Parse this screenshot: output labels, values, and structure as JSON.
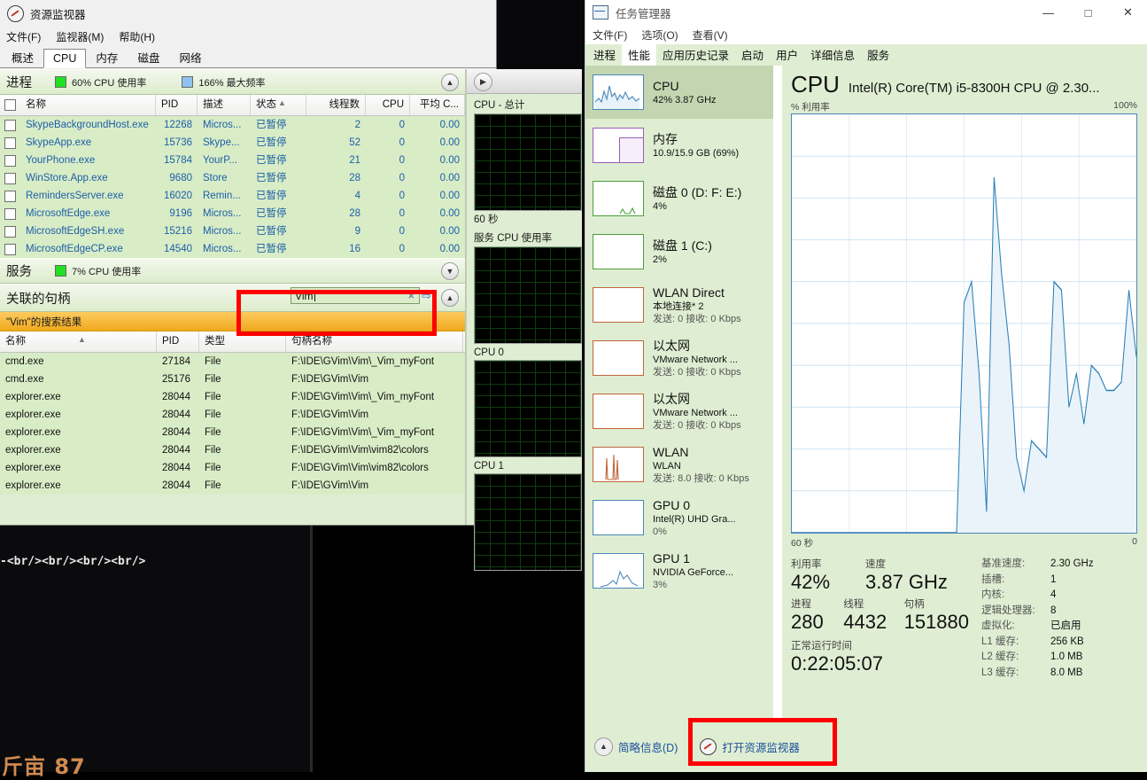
{
  "desktop": {
    "editor_line": "-<br/><br/><br/><br/>",
    "editor_bottom": "斤亩 87"
  },
  "resource_monitor": {
    "title": "资源监视器",
    "icon": "gauge-icon",
    "menu": [
      "文件(F)",
      "监视器(M)",
      "帮助(H)"
    ],
    "tabs": [
      "概述",
      "CPU",
      "内存",
      "磁盘",
      "网络"
    ],
    "active_tab": "CPU",
    "process_section": {
      "title": "进程",
      "stat_cpu": "60% CPU 使用率",
      "stat_freq": "166% 最大频率",
      "columns": [
        "名称",
        "PID",
        "描述",
        "状态",
        "线程数",
        "CPU",
        "平均 C..."
      ],
      "rows": [
        {
          "name": "SkypeBackgroundHost.exe",
          "pid": "12268",
          "desc": "Micros...",
          "status": "已暂停",
          "threads": "2",
          "cpu": "0",
          "avg": "0.00"
        },
        {
          "name": "SkypeApp.exe",
          "pid": "15736",
          "desc": "Skype...",
          "status": "已暂停",
          "threads": "52",
          "cpu": "0",
          "avg": "0.00"
        },
        {
          "name": "YourPhone.exe",
          "pid": "15784",
          "desc": "YourP...",
          "status": "已暂停",
          "threads": "21",
          "cpu": "0",
          "avg": "0.00"
        },
        {
          "name": "WinStore.App.exe",
          "pid": "9680",
          "desc": "Store",
          "status": "已暂停",
          "threads": "28",
          "cpu": "0",
          "avg": "0.00"
        },
        {
          "name": "RemindersServer.exe",
          "pid": "16020",
          "desc": "Remin...",
          "status": "已暂停",
          "threads": "4",
          "cpu": "0",
          "avg": "0.00"
        },
        {
          "name": "MicrosoftEdge.exe",
          "pid": "9196",
          "desc": "Micros...",
          "status": "已暂停",
          "threads": "28",
          "cpu": "0",
          "avg": "0.00"
        },
        {
          "name": "MicrosoftEdgeSH.exe",
          "pid": "15216",
          "desc": "Micros...",
          "status": "已暂停",
          "threads": "9",
          "cpu": "0",
          "avg": "0.00"
        },
        {
          "name": "MicrosoftEdgeCP.exe",
          "pid": "14540",
          "desc": "Micros...",
          "status": "已暂停",
          "threads": "16",
          "cpu": "0",
          "avg": "0.00"
        }
      ]
    },
    "services_section": {
      "title": "服务",
      "stat_cpu": "7% CPU 使用率"
    },
    "handles_section": {
      "title": "关联的句柄",
      "search_value": "Vim",
      "clear_icon": "×",
      "search_icon": "search-arrow-icon",
      "results_banner": "\"Vim\"的搜索结果",
      "columns": [
        "名称",
        "PID",
        "类型",
        "句柄名称"
      ],
      "rows": [
        {
          "name": "cmd.exe",
          "pid": "27184",
          "type": "File",
          "handle": "F:\\IDE\\GVim\\Vim\\_Vim_myFont"
        },
        {
          "name": "cmd.exe",
          "pid": "25176",
          "type": "File",
          "handle": "F:\\IDE\\GVim\\Vim"
        },
        {
          "name": "explorer.exe",
          "pid": "28044",
          "type": "File",
          "handle": "F:\\IDE\\GVim\\Vim\\_Vim_myFont"
        },
        {
          "name": "explorer.exe",
          "pid": "28044",
          "type": "File",
          "handle": "F:\\IDE\\GVim\\Vim"
        },
        {
          "name": "explorer.exe",
          "pid": "28044",
          "type": "File",
          "handle": "F:\\IDE\\GVim\\Vim\\_Vim_myFont"
        },
        {
          "name": "explorer.exe",
          "pid": "28044",
          "type": "File",
          "handle": "F:\\IDE\\GVim\\Vim\\vim82\\colors"
        },
        {
          "name": "explorer.exe",
          "pid": "28044",
          "type": "File",
          "handle": "F:\\IDE\\GVim\\Vim\\vim82\\colors"
        },
        {
          "name": "explorer.exe",
          "pid": "28044",
          "type": "File",
          "handle": "F:\\IDE\\GVim\\Vim"
        }
      ]
    },
    "graph_column": {
      "graphs": [
        {
          "label": "CPU - 总计",
          "footer": "60 秒"
        },
        {
          "label": "服务 CPU 使用率",
          "footer": ""
        },
        {
          "label": "CPU 0",
          "footer": ""
        },
        {
          "label": "CPU 1",
          "footer": ""
        }
      ]
    }
  },
  "task_manager": {
    "title": "任务管理器",
    "icon": "chart-window-icon",
    "window_buttons": {
      "minimize": "—",
      "maximize": "□",
      "close": "✕"
    },
    "menu": [
      "文件(F)",
      "选项(O)",
      "查看(V)"
    ],
    "tabs": [
      "进程",
      "性能",
      "应用历史记录",
      "启动",
      "用户",
      "详细信息",
      "服务"
    ],
    "active_tab": "性能",
    "sidebar": [
      {
        "name": "CPU",
        "line2": "42% 3.87 GHz",
        "line3": "",
        "color": "#4a87b8",
        "selected": true,
        "spark": "cpu"
      },
      {
        "name": "内存",
        "line2": "10.9/15.9 GB (69%)",
        "line3": "",
        "color": "#9b59b6",
        "selected": false,
        "spark": "mem"
      },
      {
        "name": "磁盘 0 (D: F: E:)",
        "line2": "4%",
        "line3": "",
        "color": "#4d9e3f",
        "selected": false,
        "spark": "disk0"
      },
      {
        "name": "磁盘 1 (C:)",
        "line2": "2%",
        "line3": "",
        "color": "#4d9e3f",
        "selected": false,
        "spark": "flat"
      },
      {
        "name": "WLAN Direct",
        "line2": "本地连接* 2",
        "line3": "发送: 0 接收: 0 Kbps",
        "color": "#c0653a",
        "selected": false,
        "spark": "flat"
      },
      {
        "name": "以太网",
        "line2": "VMware Network ...",
        "line3": "发送: 0 接收: 0 Kbps",
        "color": "#c0653a",
        "selected": false,
        "spark": "flat"
      },
      {
        "name": "以太网",
        "line2": "VMware Network ...",
        "line3": "发送: 0 接收: 0 Kbps",
        "color": "#c0653a",
        "selected": false,
        "spark": "flat"
      },
      {
        "name": "WLAN",
        "line2": "WLAN",
        "line3": "发送: 8.0 接收: 0 Kbps",
        "color": "#c0653a",
        "selected": false,
        "spark": "wlan"
      },
      {
        "name": "GPU 0",
        "line2": "Intel(R) UHD Gra...",
        "line3": "0%",
        "color": "#4a87b8",
        "selected": false,
        "spark": "flat"
      },
      {
        "name": "GPU 1",
        "line2": "NVIDIA GeForce...",
        "line3": "3%",
        "color": "#4a87b8",
        "selected": false,
        "spark": "gpu"
      }
    ],
    "detail": {
      "heading": "CPU",
      "subheading": "Intel(R) Core(TM) i5-8300H CPU @ 2.30...",
      "axis_left": "% 利用率",
      "axis_right": "100%",
      "axis_time_left": "60 秒",
      "axis_time_right": "0",
      "stats_left": [
        {
          "label": "利用率",
          "value": "42%"
        },
        {
          "label": "速度",
          "value": "3.87 GHz"
        },
        {
          "label": "进程",
          "value": "280"
        },
        {
          "label": "线程",
          "value": "4432"
        },
        {
          "label": "句柄",
          "value": "151880"
        },
        {
          "label": "正常运行时间",
          "value": "0:22:05:07"
        }
      ],
      "stats_right": [
        {
          "key": "基准速度:",
          "value": "2.30 GHz"
        },
        {
          "key": "插槽:",
          "value": "1"
        },
        {
          "key": "内核:",
          "value": "4"
        },
        {
          "key": "逻辑处理器:",
          "value": "8"
        },
        {
          "key": "虚拟化:",
          "value": "已启用"
        },
        {
          "key": "L1 缓存:",
          "value": "256 KB"
        },
        {
          "key": "L2 缓存:",
          "value": "1.0 MB"
        },
        {
          "key": "L3 缓存:",
          "value": "8.0 MB"
        }
      ]
    },
    "footer": {
      "fewer_details": "简略信息(D)",
      "open_resmon": "打开资源监视器",
      "open_resmon_icon": "gauge-icon"
    }
  },
  "chart_data": {
    "type": "area",
    "title": "CPU % 利用率",
    "ylabel": "% 利用率",
    "xlabel": "60 秒",
    "ylim": [
      0,
      100
    ],
    "xlim": [
      0,
      60
    ],
    "grid": true,
    "line_color": "#2a7fb8",
    "fill_color": "#eaf3fa",
    "x": [
      0,
      2,
      4,
      6,
      8,
      10,
      12,
      14,
      16,
      18,
      20,
      22,
      24,
      26,
      28,
      30,
      32,
      34,
      36,
      38,
      40,
      42,
      44,
      46,
      48,
      50,
      52,
      54,
      56,
      58,
      60
    ],
    "values": [
      0,
      0,
      0,
      0,
      0,
      0,
      0,
      0,
      0,
      0,
      0,
      0,
      0,
      0,
      0,
      0,
      0,
      0,
      0,
      0,
      0,
      0,
      0,
      55,
      60,
      38,
      5,
      85,
      62,
      45,
      18,
      10,
      22,
      20,
      18,
      60,
      58,
      30,
      38,
      26,
      40,
      38,
      34,
      34,
      36,
      58,
      42
    ]
  }
}
